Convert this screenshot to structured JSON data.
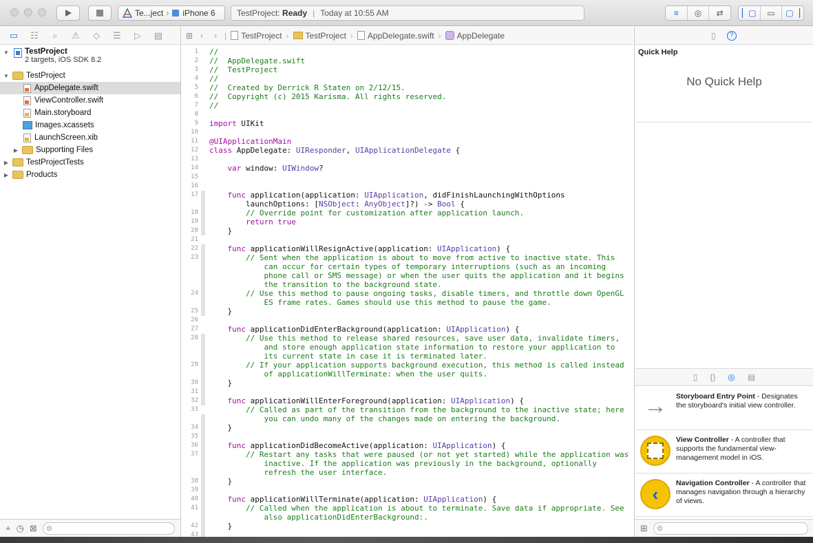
{
  "toolbar": {
    "run_icon": "play-icon",
    "stop_icon": "stop-icon",
    "scheme_project": "Te...ject",
    "scheme_separator": "›",
    "scheme_device": "iPhone 6",
    "status_project": "TestProject:",
    "status_state": "Ready",
    "status_divider": "|",
    "status_time": "Today at 10:55 AM",
    "editor_modes": [
      "standard-editor-icon",
      "assistant-editor-icon",
      "version-editor-icon"
    ],
    "view_toggles": [
      "navigator-toggle-icon",
      "debug-toggle-icon",
      "utilities-toggle-icon"
    ]
  },
  "navigator": {
    "tabs": [
      "project-navigator-icon",
      "symbol-navigator-icon",
      "find-navigator-icon",
      "issue-navigator-icon",
      "test-navigator-icon",
      "debug-navigator-icon",
      "breakpoint-navigator-icon",
      "report-navigator-icon"
    ],
    "project_name": "TestProject",
    "project_subtitle": "2 targets, iOS SDK 8.2",
    "items": [
      {
        "label": "TestProject",
        "kind": "folder",
        "indent": 1,
        "disclosure": "▼"
      },
      {
        "label": "AppDelegate.swift",
        "kind": "swift",
        "indent": 2,
        "selected": true
      },
      {
        "label": "ViewController.swift",
        "kind": "swift",
        "indent": 2
      },
      {
        "label": "Main.storyboard",
        "kind": "xib",
        "indent": 2
      },
      {
        "label": "Images.xcassets",
        "kind": "assets",
        "indent": 2
      },
      {
        "label": "LaunchScreen.xib",
        "kind": "xib",
        "indent": 2
      },
      {
        "label": "Supporting Files",
        "kind": "folder",
        "indent": 2,
        "disclosure": "▶"
      },
      {
        "label": "TestProjectTests",
        "kind": "folder",
        "indent": 1,
        "disclosure": "▶"
      },
      {
        "label": "Products",
        "kind": "folder",
        "indent": 1,
        "disclosure": "▶"
      }
    ],
    "footer_icons": [
      "add-icon",
      "recent-files-icon",
      "scm-status-icon",
      "filter-icon"
    ]
  },
  "editor": {
    "breadcrumbs": [
      "TestProject",
      "TestProject",
      "AppDelegate.swift",
      "AppDelegate"
    ],
    "lines": [
      {
        "n": "1",
        "parts": [
          [
            "c",
            "//"
          ]
        ]
      },
      {
        "n": "2",
        "parts": [
          [
            "c",
            "//  AppDelegate.swift"
          ]
        ]
      },
      {
        "n": "3",
        "parts": [
          [
            "c",
            "//  TestProject"
          ]
        ]
      },
      {
        "n": "4",
        "parts": [
          [
            "c",
            "//"
          ]
        ]
      },
      {
        "n": "5",
        "parts": [
          [
            "c",
            "//  Created by Derrick R Staten on 2/12/15."
          ]
        ]
      },
      {
        "n": "6",
        "parts": [
          [
            "c",
            "//  Copyright (c) 2015 Karisma. All rights reserved."
          ]
        ]
      },
      {
        "n": "7",
        "parts": [
          [
            "c",
            "//"
          ]
        ]
      },
      {
        "n": "8",
        "parts": []
      },
      {
        "n": "9",
        "parts": [
          [
            "k",
            "import"
          ],
          [
            "p",
            " UIKit"
          ]
        ]
      },
      {
        "n": "10",
        "parts": []
      },
      {
        "n": "11",
        "parts": [
          [
            "k",
            "@UIApplicationMain"
          ]
        ]
      },
      {
        "n": "12",
        "parts": [
          [
            "k",
            "class"
          ],
          [
            "p",
            " AppDelegate: "
          ],
          [
            "t",
            "UIResponder"
          ],
          [
            "p",
            ", "
          ],
          [
            "t",
            "UIApplicationDelegate"
          ],
          [
            "p",
            " {"
          ]
        ]
      },
      {
        "n": "13",
        "parts": []
      },
      {
        "n": "14",
        "parts": [
          [
            "p",
            "    "
          ],
          [
            "k",
            "var"
          ],
          [
            "p",
            " window: "
          ],
          [
            "t",
            "UIWindow"
          ],
          [
            "p",
            "?"
          ]
        ]
      },
      {
        "n": "15",
        "parts": []
      },
      {
        "n": "16",
        "parts": []
      },
      {
        "n": "17",
        "parts": [
          [
            "p",
            "    "
          ],
          [
            "k",
            "func"
          ],
          [
            "p",
            " application(application: "
          ],
          [
            "t",
            "UIApplication"
          ],
          [
            "p",
            ", didFinishLaunchingWithOptions"
          ]
        ]
      },
      {
        "n": "",
        "parts": [
          [
            "p",
            "        launchOptions: ["
          ],
          [
            "t",
            "NSObject"
          ],
          [
            "p",
            ": "
          ],
          [
            "t",
            "AnyObject"
          ],
          [
            "p",
            "]?) -> "
          ],
          [
            "t",
            "Bool"
          ],
          [
            "p",
            " {"
          ]
        ]
      },
      {
        "n": "18",
        "parts": [
          [
            "c",
            "        // Override point for customization after application launch."
          ]
        ]
      },
      {
        "n": "19",
        "parts": [
          [
            "p",
            "        "
          ],
          [
            "k",
            "return"
          ],
          [
            "p",
            " "
          ],
          [
            "k",
            "true"
          ]
        ]
      },
      {
        "n": "20",
        "parts": [
          [
            "p",
            "    }"
          ]
        ]
      },
      {
        "n": "21",
        "parts": []
      },
      {
        "n": "22",
        "parts": [
          [
            "p",
            "    "
          ],
          [
            "k",
            "func"
          ],
          [
            "p",
            " applicationWillResignActive(application: "
          ],
          [
            "t",
            "UIApplication"
          ],
          [
            "p",
            ") {"
          ]
        ]
      },
      {
        "n": "23",
        "parts": [
          [
            "c",
            "        // Sent when the application is about to move from active to inactive state. This"
          ]
        ]
      },
      {
        "n": "",
        "parts": [
          [
            "c",
            "            can occur for certain types of temporary interruptions (such as an incoming"
          ]
        ]
      },
      {
        "n": "",
        "parts": [
          [
            "c",
            "            phone call or SMS message) or when the user quits the application and it begins"
          ]
        ]
      },
      {
        "n": "",
        "parts": [
          [
            "c",
            "            the transition to the background state."
          ]
        ]
      },
      {
        "n": "24",
        "parts": [
          [
            "c",
            "        // Use this method to pause ongoing tasks, disable timers, and throttle down OpenGL"
          ]
        ]
      },
      {
        "n": "",
        "parts": [
          [
            "c",
            "            ES frame rates. Games should use this method to pause the game."
          ]
        ]
      },
      {
        "n": "25",
        "parts": [
          [
            "p",
            "    }"
          ]
        ]
      },
      {
        "n": "26",
        "parts": []
      },
      {
        "n": "27",
        "parts": [
          [
            "p",
            "    "
          ],
          [
            "k",
            "func"
          ],
          [
            "p",
            " applicationDidEnterBackground(application: "
          ],
          [
            "t",
            "UIApplication"
          ],
          [
            "p",
            ") {"
          ]
        ]
      },
      {
        "n": "28",
        "parts": [
          [
            "c",
            "        // Use this method to release shared resources, save user data, invalidate timers,"
          ]
        ]
      },
      {
        "n": "",
        "parts": [
          [
            "c",
            "            and store enough application state information to restore your application to"
          ]
        ]
      },
      {
        "n": "",
        "parts": [
          [
            "c",
            "            its current state in case it is terminated later."
          ]
        ]
      },
      {
        "n": "29",
        "parts": [
          [
            "c",
            "        // If your application supports background execution, this method is called instead"
          ]
        ]
      },
      {
        "n": "",
        "parts": [
          [
            "c",
            "            of applicationWillTerminate: when the user quits."
          ]
        ]
      },
      {
        "n": "30",
        "parts": [
          [
            "p",
            "    }"
          ]
        ]
      },
      {
        "n": "31",
        "parts": []
      },
      {
        "n": "32",
        "parts": [
          [
            "p",
            "    "
          ],
          [
            "k",
            "func"
          ],
          [
            "p",
            " applicationWillEnterForeground(application: "
          ],
          [
            "t",
            "UIApplication"
          ],
          [
            "p",
            ") {"
          ]
        ]
      },
      {
        "n": "33",
        "parts": [
          [
            "c",
            "        // Called as part of the transition from the background to the inactive state; here"
          ]
        ]
      },
      {
        "n": "",
        "parts": [
          [
            "c",
            "            you can undo many of the changes made on entering the background."
          ]
        ]
      },
      {
        "n": "34",
        "parts": [
          [
            "p",
            "    }"
          ]
        ]
      },
      {
        "n": "35",
        "parts": []
      },
      {
        "n": "36",
        "parts": [
          [
            "p",
            "    "
          ],
          [
            "k",
            "func"
          ],
          [
            "p",
            " applicationDidBecomeActive(application: "
          ],
          [
            "t",
            "UIApplication"
          ],
          [
            "p",
            ") {"
          ]
        ]
      },
      {
        "n": "37",
        "parts": [
          [
            "c",
            "        // Restart any tasks that were paused (or not yet started) while the application was"
          ]
        ]
      },
      {
        "n": "",
        "parts": [
          [
            "c",
            "            inactive. If the application was previously in the background, optionally"
          ]
        ]
      },
      {
        "n": "",
        "parts": [
          [
            "c",
            "            refresh the user interface."
          ]
        ]
      },
      {
        "n": "38",
        "parts": [
          [
            "p",
            "    }"
          ]
        ]
      },
      {
        "n": "39",
        "parts": []
      },
      {
        "n": "40",
        "parts": [
          [
            "p",
            "    "
          ],
          [
            "k",
            "func"
          ],
          [
            "p",
            " applicationWillTerminate(application: "
          ],
          [
            "t",
            "UIApplication"
          ],
          [
            "p",
            ") {"
          ]
        ]
      },
      {
        "n": "41",
        "parts": [
          [
            "c",
            "        // Called when the application is about to terminate. Save data if appropriate. See"
          ]
        ]
      },
      {
        "n": "",
        "parts": [
          [
            "c",
            "            also applicationDidEnterBackground:."
          ]
        ]
      },
      {
        "n": "42",
        "parts": [
          [
            "p",
            "    }"
          ]
        ]
      },
      {
        "n": "43",
        "parts": []
      }
    ]
  },
  "inspector": {
    "tabs": [
      "file-inspector-icon",
      "quick-help-icon"
    ],
    "quick_help_title": "Quick Help",
    "no_quick_help": "No Quick Help",
    "library_tabs": [
      "file-template-icon",
      "code-snippet-icon",
      "object-library-icon",
      "media-library-icon"
    ],
    "library_items": [
      {
        "title": "Storyboard Entry Point",
        "desc": " - Designates the storyboard's initial view controller.",
        "icon": "entry-arrow-icon"
      },
      {
        "title": "View Controller",
        "desc": " - A controller that supports the fundamental view-management model in iOS.",
        "icon": "view-controller-icon"
      },
      {
        "title": "Navigation Controller",
        "desc": " - A controller that manages navigation through a hierarchy of views.",
        "icon": "navigation-controller-icon"
      }
    ]
  },
  "colors": {
    "comment": "#1c7d1c",
    "keyword": "#a00ea0",
    "type": "#5b3aa6",
    "accent": "#1a6fe0"
  }
}
